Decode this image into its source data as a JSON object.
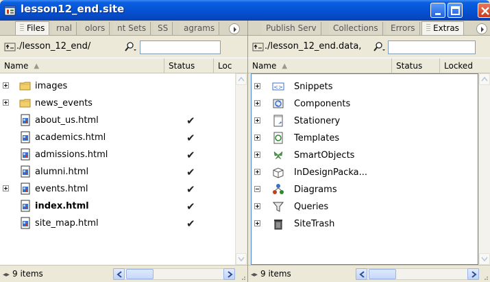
{
  "window": {
    "title": "lesson12_end.site"
  },
  "left_panel": {
    "tabs": [
      {
        "label": "Files",
        "active": true
      },
      {
        "label": "rnal",
        "active": false
      },
      {
        "label": "olors",
        "active": false
      },
      {
        "label": "nt Sets",
        "active": false
      },
      {
        "label": "SS",
        "active": false
      },
      {
        "label": "agrams",
        "active": false
      }
    ],
    "path": "./lesson_12_end/",
    "search_value": "",
    "columns": {
      "name": "Name",
      "status": "Status",
      "locked": "Loc"
    },
    "rows": [
      {
        "label": "images",
        "icon": "folder-icon",
        "expandable": true,
        "checked": false,
        "bold": false
      },
      {
        "label": "news_events",
        "icon": "folder-icon",
        "expandable": true,
        "checked": false,
        "bold": false
      },
      {
        "label": "about_us.html",
        "icon": "html-file-icon",
        "expandable": false,
        "checked": true,
        "bold": false
      },
      {
        "label": "academics.html",
        "icon": "html-file-icon",
        "expandable": false,
        "checked": true,
        "bold": false
      },
      {
        "label": "admissions.html",
        "icon": "html-file-icon",
        "expandable": false,
        "checked": true,
        "bold": false
      },
      {
        "label": "alumni.html",
        "icon": "html-file-icon",
        "expandable": false,
        "checked": true,
        "bold": false
      },
      {
        "label": "events.html",
        "icon": "html-file-icon",
        "expandable": true,
        "checked": true,
        "bold": false
      },
      {
        "label": "index.html",
        "icon": "html-file-icon",
        "expandable": false,
        "checked": true,
        "bold": true
      },
      {
        "label": "site_map.html",
        "icon": "html-file-icon",
        "expandable": false,
        "checked": true,
        "bold": false
      }
    ],
    "status": "9 items",
    "check_glyph": "✔"
  },
  "right_panel": {
    "tabs": [
      {
        "label": "Publish Serv",
        "active": false
      },
      {
        "label": "Collections",
        "active": false
      },
      {
        "label": "Errors",
        "active": false
      },
      {
        "label": "Extras",
        "active": true
      }
    ],
    "path": "./lesson_12_end.data,",
    "search_value": "",
    "columns": {
      "name": "Name",
      "status": "Status",
      "locked": "Locked"
    },
    "rows": [
      {
        "label": "Snippets",
        "icon": "snippets-icon",
        "expanded": false
      },
      {
        "label": "Components",
        "icon": "components-icon",
        "expanded": false
      },
      {
        "label": "Stationery",
        "icon": "stationery-icon",
        "expanded": false
      },
      {
        "label": "Templates",
        "icon": "templates-icon",
        "expanded": false
      },
      {
        "label": "SmartObjects",
        "icon": "smartobjects-icon",
        "expanded": false
      },
      {
        "label": "InDesignPacka...",
        "icon": "indesign-package-icon",
        "expanded": false
      },
      {
        "label": "Diagrams",
        "icon": "diagrams-icon",
        "expanded": true
      },
      {
        "label": "Queries",
        "icon": "queries-icon",
        "expanded": false
      },
      {
        "label": "SiteTrash",
        "icon": "trash-icon",
        "expanded": false
      }
    ],
    "status": "9 items"
  },
  "colors": {
    "titlebar": "#0553d4",
    "panel_bg": "#ece9d8",
    "selection_border": "#4a82d8",
    "folder": "#f2cf6a"
  }
}
